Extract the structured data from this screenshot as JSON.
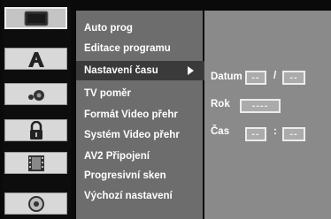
{
  "icons": [
    {
      "name": "display-icon"
    },
    {
      "name": "language-icon"
    },
    {
      "name": "audio-icon"
    },
    {
      "name": "lock-icon"
    },
    {
      "name": "film-icon"
    },
    {
      "name": "disc-icon"
    }
  ],
  "menu": {
    "items": [
      {
        "label": "Auto prog"
      },
      {
        "label": "Editace programu"
      },
      {
        "label": "Nastavení času"
      },
      {
        "label": "TV poměr"
      },
      {
        "label": "Formát Video přehr"
      },
      {
        "label": "Systém Video přehr"
      },
      {
        "label": "AV2 Připojení"
      },
      {
        "label": "Progresivní sken"
      },
      {
        "label": "Výchozí nastavení"
      }
    ],
    "active_index": 2
  },
  "panel": {
    "datum_label": "Datum",
    "datum_day": "--",
    "datum_sep": "/",
    "datum_month": "--",
    "rok_label": "Rok",
    "rok_value": "----",
    "cas_label": "Čas",
    "cas_hour": "--",
    "cas_sep": ":",
    "cas_minute": "--"
  }
}
